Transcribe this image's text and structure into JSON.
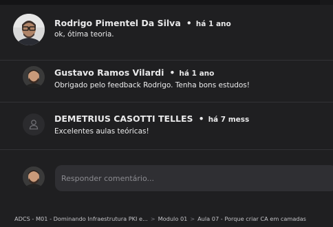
{
  "comments": [
    {
      "author": "Rodrigo Pimentel Da Silva",
      "separator": "•",
      "time": "há 1 ano",
      "text": "ok, ótima teoria.",
      "avatar": "photo-avatar-glasses"
    },
    {
      "author": "Gustavo Ramos Vilardi",
      "separator": "•",
      "time": "há 1 ano",
      "text": "Obrigado pelo feedback Rodrigo. Tenha bons estudos!",
      "avatar": "photo-avatar-beard"
    },
    {
      "author": "DEMETRIUS CASOTTI TELLES",
      "separator": "•",
      "time": "há 7 mess",
      "text": "Excelentes aulas teóricas!",
      "avatar": "user-icon"
    }
  ],
  "reply": {
    "placeholder": "Responder comentário..."
  },
  "breadcrumb": {
    "items": [
      "ADCS - M01 - Dominando Infraestrutura PKI e...",
      "Modulo 01",
      "Aula 07 - Porque criar CA em camadas"
    ],
    "separator": ">"
  },
  "colors": {
    "background": "#1f1f21",
    "divider": "#323236",
    "input_bg": "#2f2f33"
  }
}
